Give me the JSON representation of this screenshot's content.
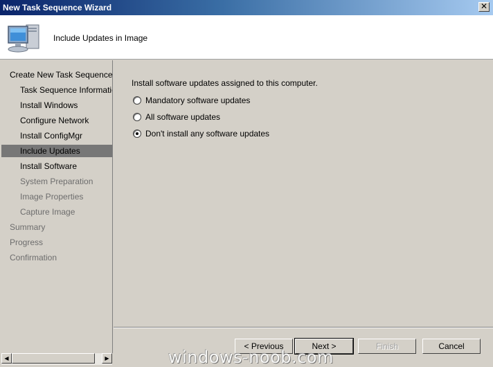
{
  "window": {
    "title": "New Task Sequence Wizard",
    "close_glyph": "✕"
  },
  "header": {
    "icon": "computer-monitor-icon",
    "title": "Include Updates in Image"
  },
  "sidebar": {
    "items": [
      {
        "label": "Create New Task Sequence",
        "level": 0,
        "state": "done"
      },
      {
        "label": "Task Sequence Information",
        "level": 1,
        "state": "done"
      },
      {
        "label": "Install Windows",
        "level": 1,
        "state": "done"
      },
      {
        "label": "Configure Network",
        "level": 1,
        "state": "done"
      },
      {
        "label": "Install ConfigMgr",
        "level": 1,
        "state": "done"
      },
      {
        "label": "Include Updates",
        "level": 1,
        "state": "active"
      },
      {
        "label": "Install Software",
        "level": 1,
        "state": "done"
      },
      {
        "label": "System Preparation",
        "level": 1,
        "state": "todo"
      },
      {
        "label": "Image Properties",
        "level": 1,
        "state": "todo"
      },
      {
        "label": "Capture Image",
        "level": 1,
        "state": "todo"
      },
      {
        "label": "Summary",
        "level": 0,
        "state": "todo"
      },
      {
        "label": "Progress",
        "level": 0,
        "state": "todo"
      },
      {
        "label": "Confirmation",
        "level": 0,
        "state": "todo"
      }
    ]
  },
  "main": {
    "prompt": "Install software updates assigned to this computer.",
    "options": [
      {
        "label": "Mandatory software updates",
        "checked": false
      },
      {
        "label": "All software updates",
        "checked": false
      },
      {
        "label": "Don't install any software updates",
        "checked": true
      }
    ]
  },
  "buttons": {
    "previous": "< Previous",
    "next": "Next >",
    "finish": "Finish",
    "cancel": "Cancel"
  },
  "watermark": "windows-noob.com",
  "colors": {
    "title_gradient_start": "#0a246a",
    "title_gradient_end": "#a6caf0",
    "selected_item": "#777777",
    "face": "#d4d0c8"
  }
}
